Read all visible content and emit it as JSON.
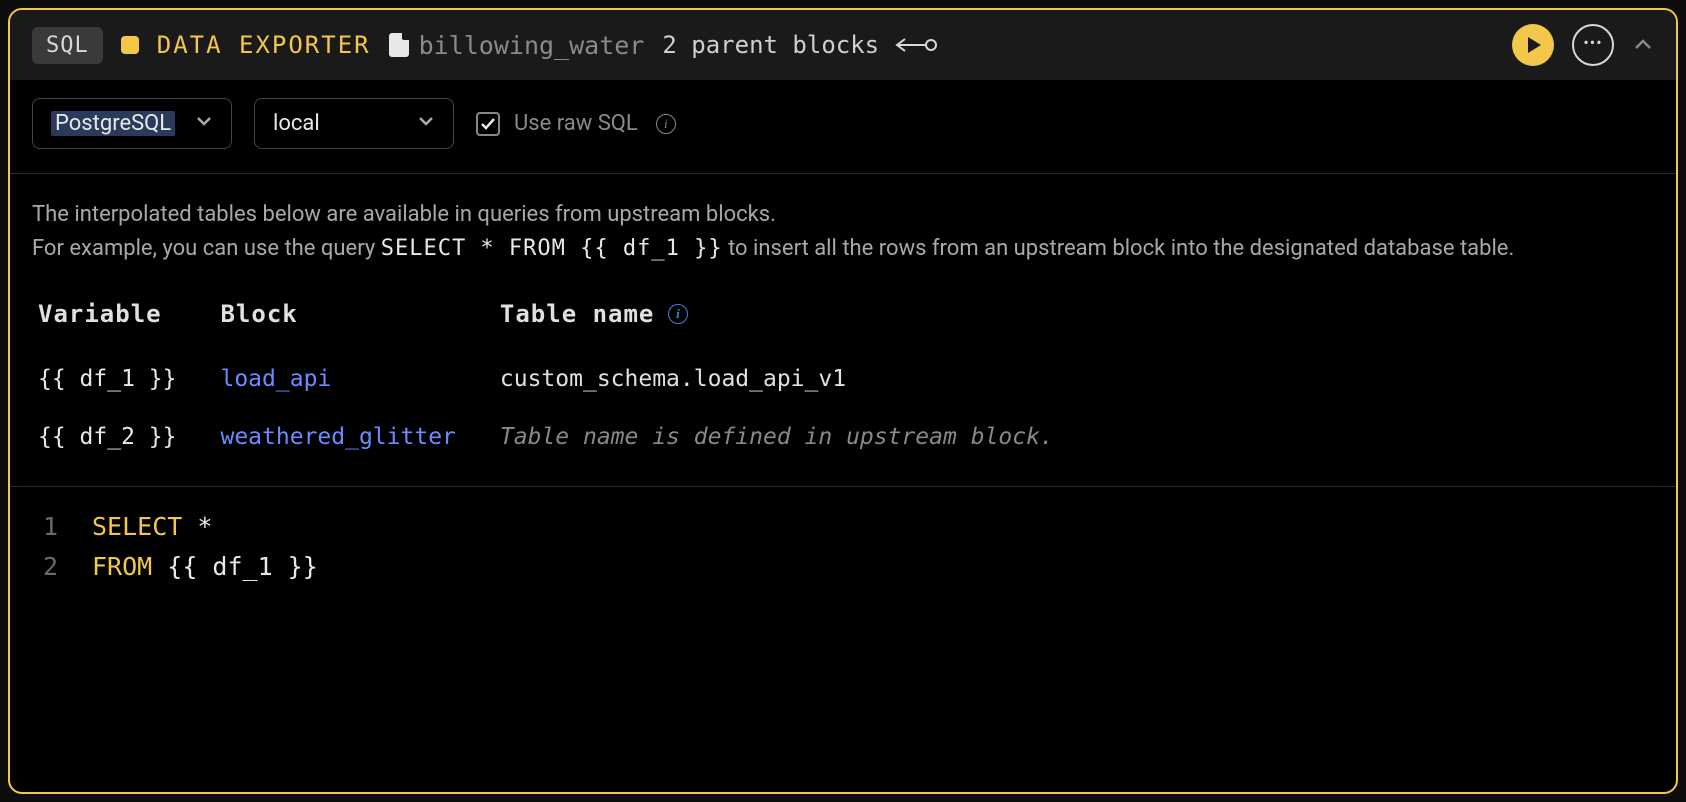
{
  "header": {
    "language_badge": "SQL",
    "block_type": "DATA EXPORTER",
    "block_name": "billowing_water",
    "parent_blocks_text": "2 parent blocks"
  },
  "config": {
    "db_engine": "PostgreSQL",
    "connection": "local",
    "use_raw_sql_label": "Use raw SQL"
  },
  "description": {
    "line1": "The interpolated tables below are available in queries from upstream blocks.",
    "line2_a": "For example, you can use the query ",
    "line2_code": "SELECT * FROM {{ df_1 }}",
    "line2_b": " to insert all the rows from an upstream block into the designated database table."
  },
  "vars_table": {
    "headers": {
      "variable": "Variable",
      "block": "Block",
      "table_name": "Table name"
    },
    "rows": [
      {
        "variable": "{{ df_1 }}",
        "block": "load_api",
        "table_name": "custom_schema.load_api_v1",
        "is_note": false
      },
      {
        "variable": "{{ df_2 }}",
        "block": "weathered_glitter",
        "table_name": "Table name is defined in upstream block.",
        "is_note": true
      }
    ]
  },
  "editor": {
    "lines": [
      {
        "num": "1",
        "tokens": [
          {
            "t": "SELECT",
            "c": "kw"
          },
          {
            "t": " *",
            "c": "txt"
          }
        ]
      },
      {
        "num": "2",
        "tokens": [
          {
            "t": "FROM",
            "c": "kw"
          },
          {
            "t": " {{ df_1 }}",
            "c": "txt"
          }
        ]
      }
    ]
  }
}
